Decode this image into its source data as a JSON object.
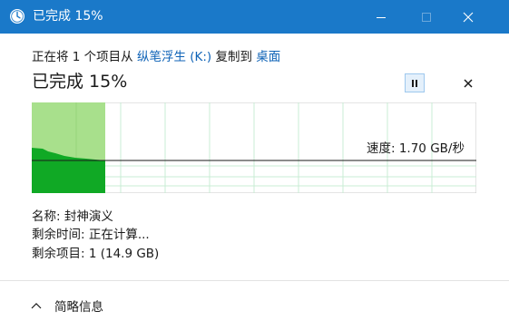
{
  "window": {
    "title": "已完成 15%"
  },
  "copy": {
    "prefix": "正在将 1 个项目从",
    "source": "纵笔浮生 (K:)",
    "middle": "复制到",
    "destination": "桌面"
  },
  "progress": {
    "title": "已完成 15%",
    "percent": 15,
    "speed": "速度: 1.70 GB/秒"
  },
  "details": {
    "name": "名称: 封神演义",
    "time_remaining": "剩余时间: 正在计算...",
    "items_remaining": "剩余项目: 1 (14.9 GB)"
  },
  "footer": {
    "toggle_label": "简略信息"
  },
  "colors": {
    "titlebar": "#1a79c9",
    "graph_done": "#a8e08c",
    "graph_speed": "#10a925",
    "graph_grid": "#c9ecd4",
    "link": "#0f63b7"
  },
  "icons": {
    "title": "clock-icon",
    "minimize": "minimize-icon",
    "maximize": "maximize-icon",
    "close": "close-icon",
    "pause": "pause-icon",
    "cancel": "close-icon",
    "footer": "chevron-up-icon"
  }
}
